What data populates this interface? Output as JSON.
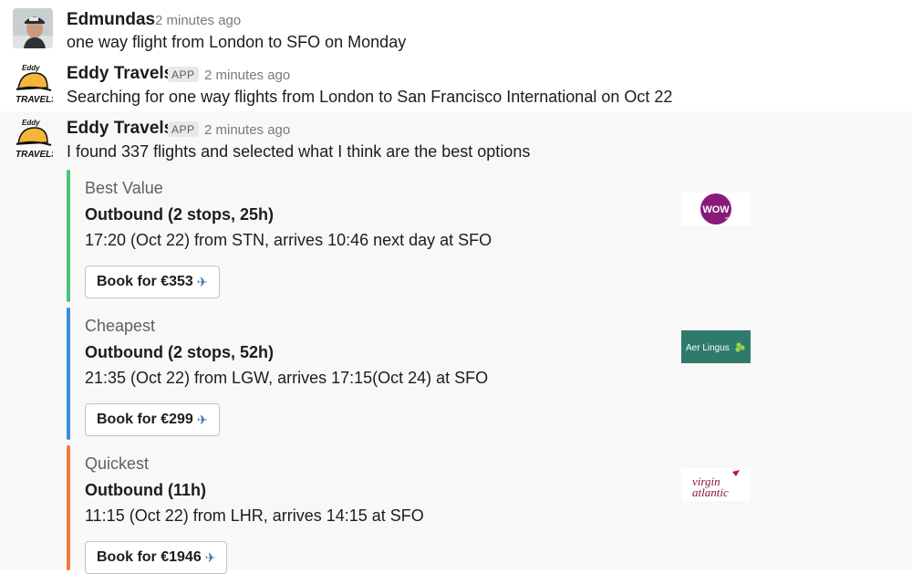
{
  "messages": [
    {
      "author": "Edmundas",
      "time": "2 minutes ago",
      "text": "one way flight from London to SFO on Monday"
    },
    {
      "author": "Eddy Travels",
      "badge": "APP",
      "time": "2 minutes ago",
      "text": "Searching for one way flights from London to San Francisco International on Oct 22"
    },
    {
      "author": "Eddy Travels",
      "badge": "APP",
      "time": "2 minutes ago",
      "text": "I found 337 flights and selected what I think are the best options"
    }
  ],
  "bot_avatar": {
    "line1": "Eddy",
    "line2": "TRAVELS"
  },
  "options": [
    {
      "title": "Best Value",
      "subtitle": "Outbound (2 stops, 25h)",
      "detail": "17:20 (Oct 22) from STN, arrives 10:46 next day at SFO",
      "button": "Book for €353",
      "airline_logo_text": "WOW",
      "airline_logo_small": "air",
      "bar_color": "#4cc47a"
    },
    {
      "title": "Cheapest",
      "subtitle": "Outbound (2 stops, 52h)",
      "detail": "21:35 (Oct 22) from LGW, arrives 17:15(Oct 24) at SFO",
      "button": "Book for €299",
      "airline_logo_text": "Aer Lingus",
      "bar_color": "#3a8fd8"
    },
    {
      "title": "Quickest",
      "subtitle": "Outbound (11h)",
      "detail": "11:15 (Oct 22) from LHR, arrives 14:15 at SFO",
      "button": "Book for €1946",
      "airline_logo_text": "virgin",
      "airline_logo_text2": "atlantic",
      "bar_color": "#ef7a3c"
    }
  ]
}
